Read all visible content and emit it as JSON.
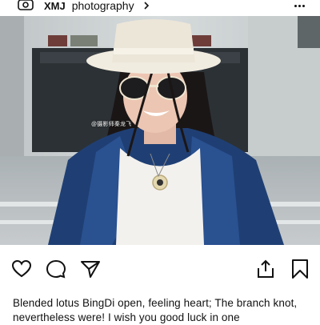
{
  "header": {
    "account_name": "XMJ",
    "account_subtitle": "photography",
    "logo_icon": "logo-icon",
    "more_icon": "more-dots-icon"
  },
  "photo": {
    "watermark": "@摄影师秦龙飞"
  },
  "actions": {
    "like_icon": "heart-icon",
    "comment_icon": "comment-icon",
    "share_icon": "send-icon",
    "upload_icon": "upload-icon",
    "save_icon": "bookmark-icon"
  },
  "caption": {
    "text": "Blended lotus BingDi open, feeling heart; The branch knot, nevertheless were! I wish you good luck in one"
  },
  "colors": {
    "coat": "#1f3f74",
    "hat": "#f1ece0",
    "background_wall": "#c9cfd0"
  }
}
